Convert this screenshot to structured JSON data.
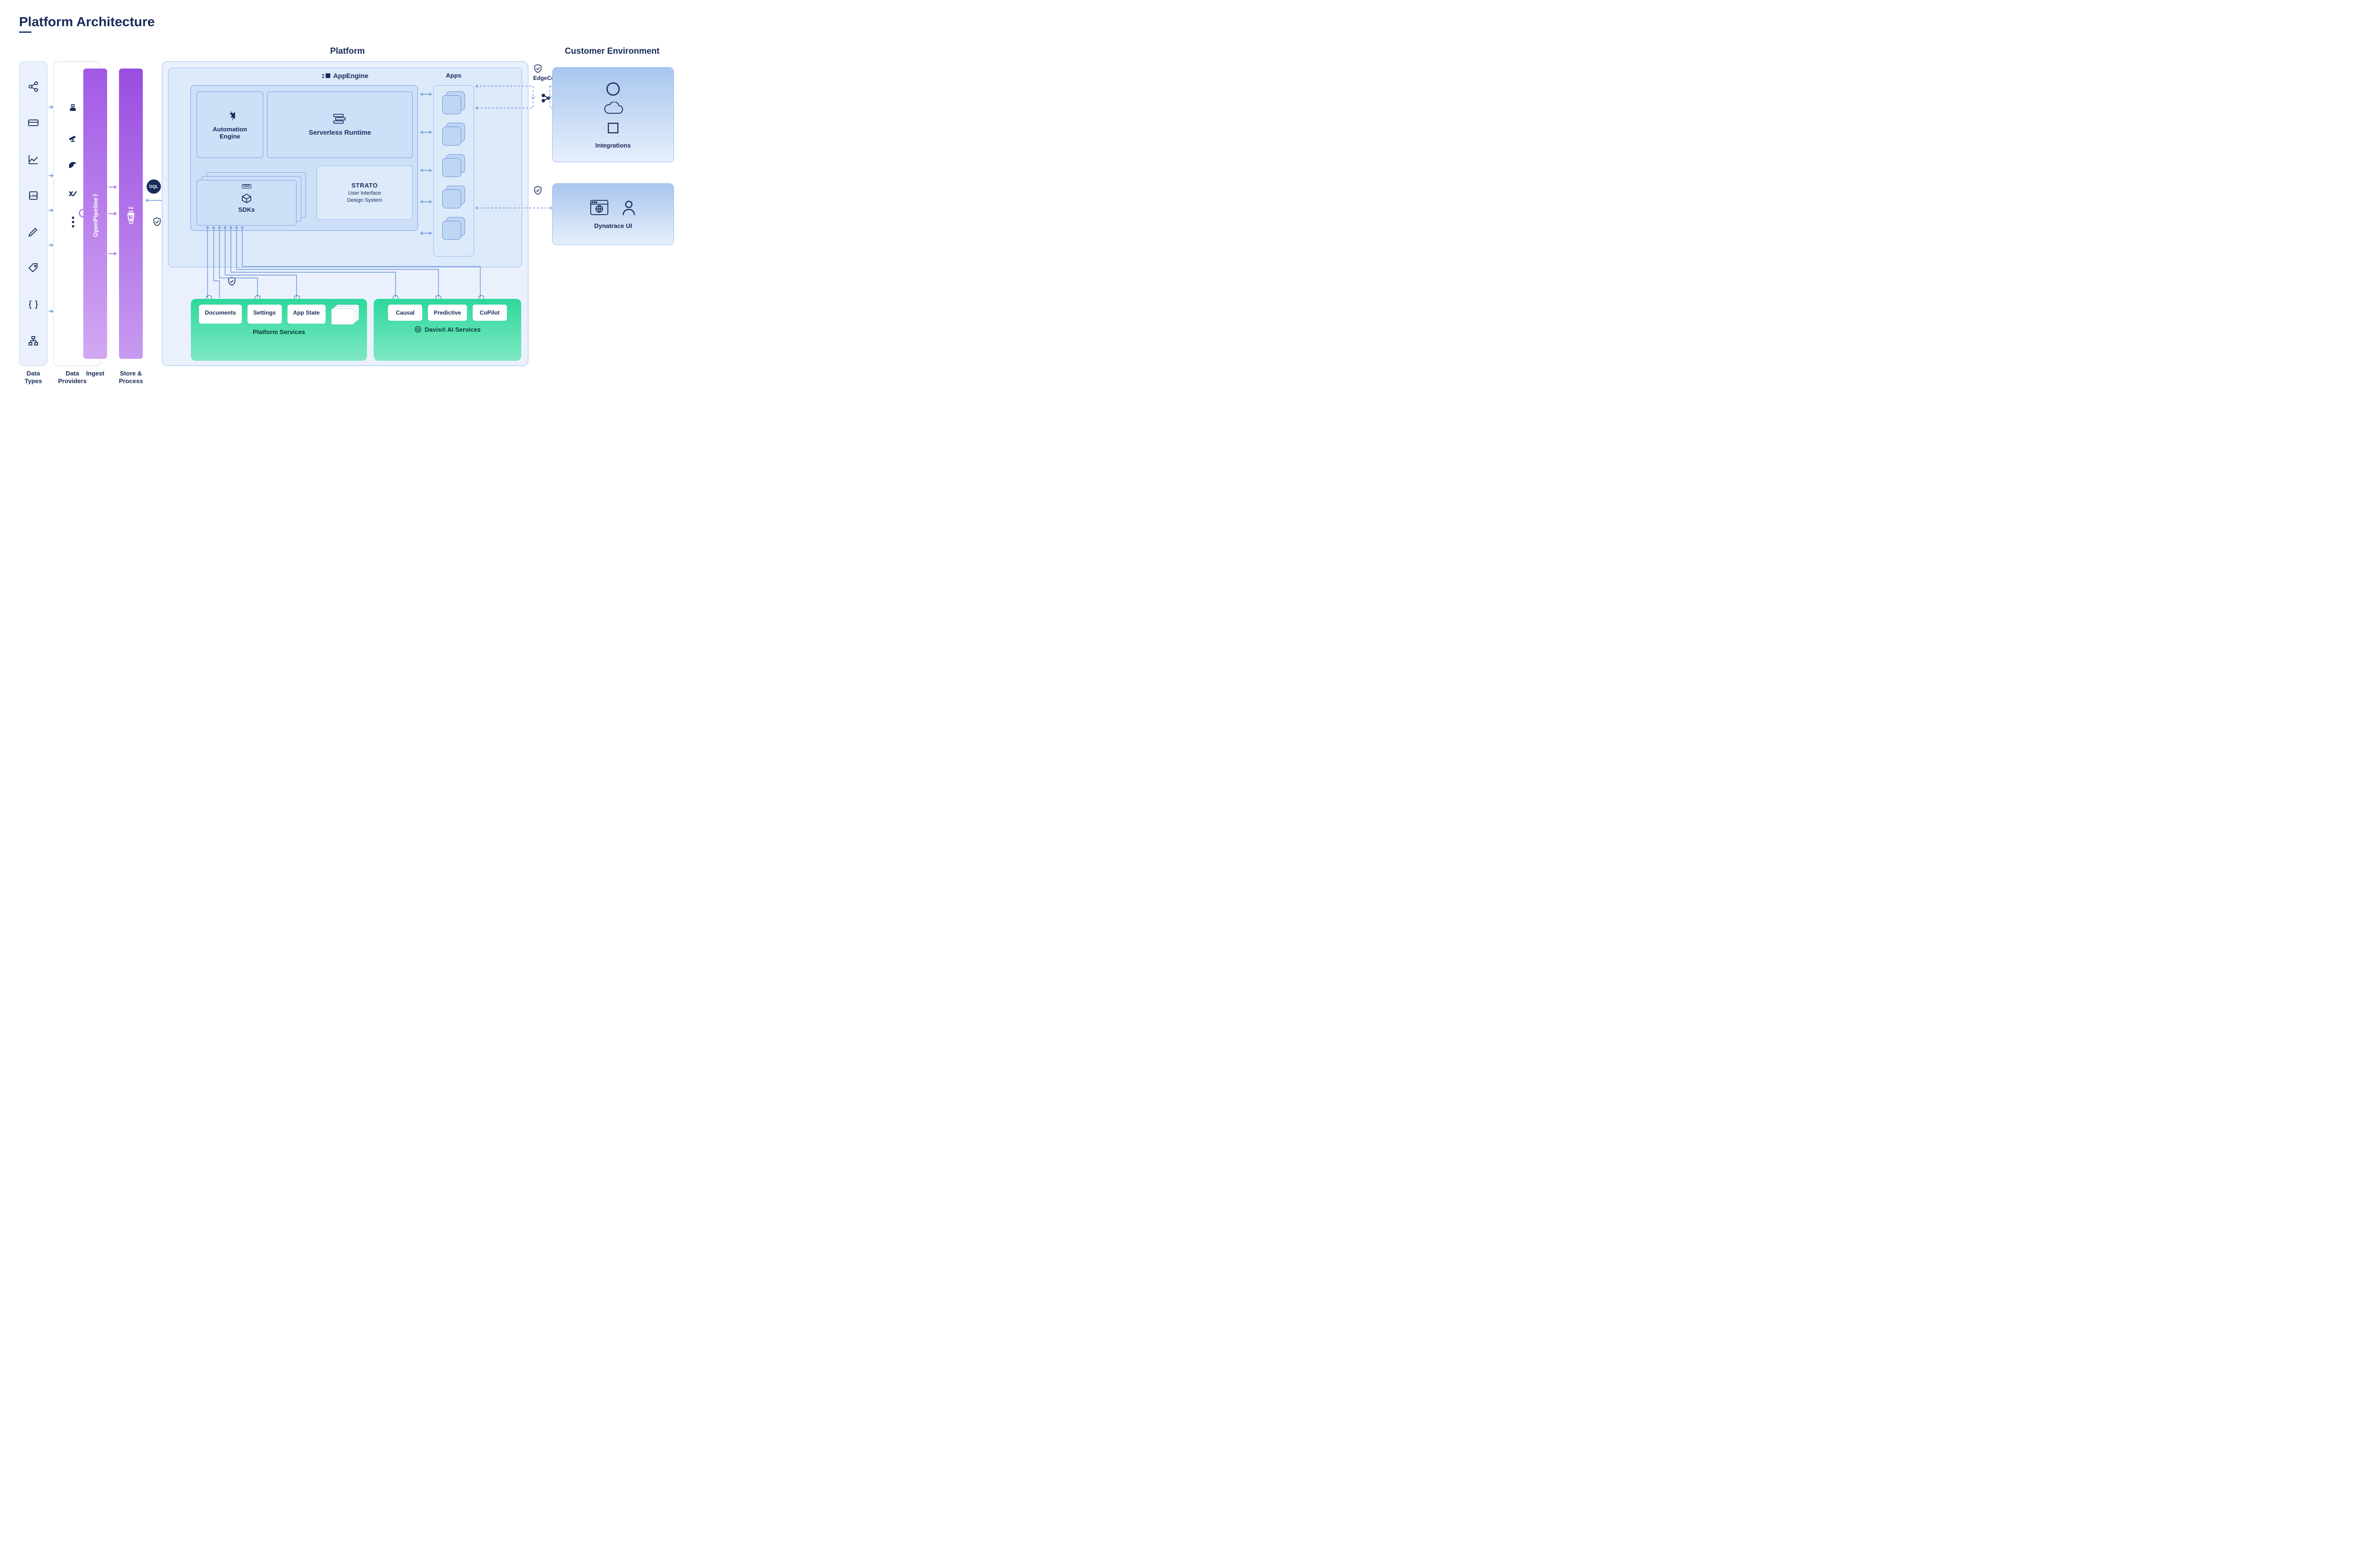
{
  "title": "Platform Architecture",
  "sections": {
    "platform": "Platform",
    "customer_env": "Customer Environment"
  },
  "columns": {
    "data_types": "Data\nTypes",
    "data_providers": "Data\nProviders",
    "ingest": "Ingest",
    "store_process": "Store &\nProcess"
  },
  "ingest_label": "OpenPipeline™",
  "store_label": "Grail™",
  "dql_badge": "DQL",
  "appengine": {
    "header": "AppEngine",
    "automation": "Automation\nEngine",
    "serverless": "Serverless Runtime",
    "sdks": "SDKs",
    "sdks_badge": "SDK",
    "strato_title": "STRATO",
    "strato_sub": "User Interface\nDesign System",
    "apps": "Apps"
  },
  "platform_services": {
    "label": "Platform Services",
    "tiles": [
      "Documents",
      "Settings",
      "App State"
    ]
  },
  "ai_services": {
    "label": "Davis® AI Services",
    "tiles": [
      "Causal",
      "Predictive",
      "CoPilot"
    ]
  },
  "customer": {
    "edgeconnect": "EdgeConnect",
    "integrations": "Integrations",
    "ui": "Dynatrace UI"
  }
}
